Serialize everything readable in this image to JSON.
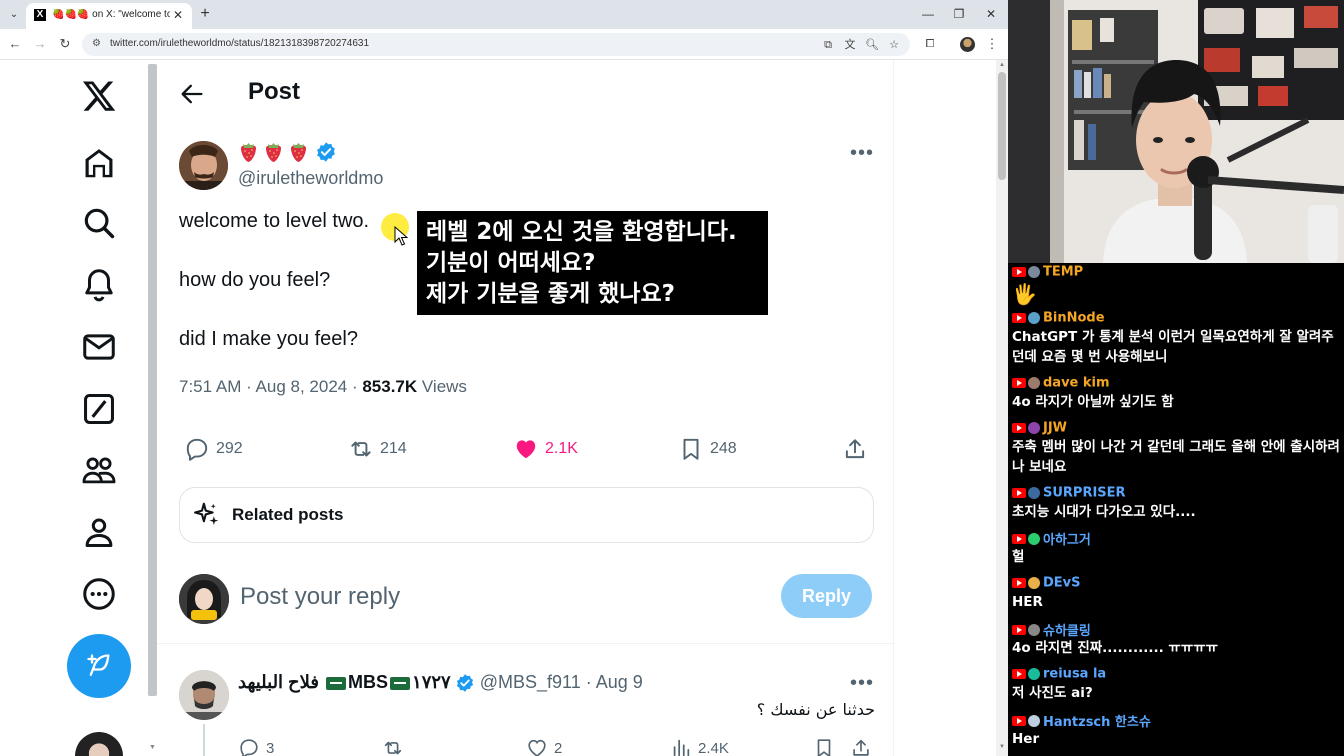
{
  "browser": {
    "tab_title": "🍓🍓🍓 on X: \"welcome to l",
    "url": "twitter.com/iruletheworldmo/status/1821318398720274631"
  },
  "nav": {
    "items": [
      "home",
      "explore",
      "notifications",
      "messages",
      "grok",
      "communities",
      "profile",
      "more"
    ]
  },
  "header": {
    "title": "Post"
  },
  "tweet": {
    "handle": "@iruletheworldmo",
    "lines": [
      "welcome to level two.",
      "how do you feel?",
      "did I make you feel?"
    ],
    "time": "7:51 AM · Aug 8, 2024 · ",
    "views_count": "853.7K",
    "views_label": " Views",
    "replies": "292",
    "reposts": "214",
    "likes": "2.1K",
    "bookmarks": "248"
  },
  "subtitle": {
    "lines": [
      "레벨 2에 오신 것을 환영합니다.",
      "기분이 어떠세요?",
      "제가 기분을 좋게 했나요?"
    ]
  },
  "related": {
    "label": "Related posts"
  },
  "reply_box": {
    "placeholder": "Post your reply",
    "button": "Reply"
  },
  "reply2": {
    "name_prefix": "فلاح البليهد ",
    "name_mid": "MBS",
    "name_suffix": "١٧٢٧",
    "handle": " @MBS_f911 · Aug 9",
    "text": "حدثنا عن نفسك ؟",
    "replies": "3",
    "likes": "2",
    "views": "2.4K"
  },
  "chat": [
    {
      "name": "TEMP",
      "name_color": "#f5a623",
      "avatar_color": "#7a8a9a",
      "text": "🖐"
    },
    {
      "name": "BinNode",
      "name_color": "#f5a623",
      "avatar_color": "#5aa0c8",
      "text": "ChatGPT 가 통계 분석 이런거 일목요연하게 잘 알려주던데 요즘 몇 번 사용해보니"
    },
    {
      "name": "dave kim",
      "name_color": "#f5a623",
      "avatar_color": "#9b7b6b",
      "text": "4o 라지가 아닐까 싶기도 함"
    },
    {
      "name": "JJW",
      "name_color": "#f5a623",
      "avatar_color": "#8e44ad",
      "text": "주축 멤버 많이 나간 거 같던데 그래도 올해 안에 출시하려나 보네요"
    },
    {
      "name": "SURPRISER",
      "name_color": "#5aa7ff",
      "avatar_color": "#3a6aa0",
      "text": "초지능 시대가 다가오고 있다...."
    },
    {
      "name": "아하그거",
      "name_color": "#5aa7ff",
      "avatar_color": "#2ecc71",
      "text": "헐"
    },
    {
      "name": "DEvS",
      "name_color": "#5aa7ff",
      "avatar_color": "#e8b04a",
      "text": "HER"
    },
    {
      "name": "슈하클링",
      "name_color": "#5aa7ff",
      "avatar_color": "#888888",
      "text": "4o 라지면 진짜............ ㅠㅠㅠㅠ"
    },
    {
      "name": "reiusa la",
      "name_color": "#5aa7ff",
      "avatar_color": "#1abc9c",
      "text": "저 사진도 ai?"
    },
    {
      "name": "Hantzsch 한츠슈",
      "name_color": "#5aa7ff",
      "avatar_color": "#bcd0e0",
      "text": "Her"
    }
  ],
  "colors": {
    "x_blue": "#1d9bf0",
    "like_pink": "#f91880",
    "muted_gray": "#536471",
    "text_dark": "#0f1419"
  }
}
